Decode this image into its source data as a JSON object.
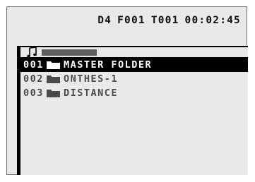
{
  "status": {
    "disc": "D4",
    "folder": "F001",
    "track": "T001",
    "time": "00:02:45"
  },
  "header": {
    "icon": "music-note-icon"
  },
  "list": {
    "items": [
      {
        "number": "001",
        "name": "MASTER FOLDER",
        "icon": "folder-icon",
        "selected": true
      },
      {
        "number": "002",
        "name": "ONTHES-1",
        "icon": "folder-icon",
        "selected": false
      },
      {
        "number": "003",
        "name": "DISTANCE",
        "icon": "folder-icon",
        "selected": false
      }
    ]
  },
  "colors": {
    "background": "#e9e9e9",
    "selection": "#000000",
    "text": "#4a4a4a",
    "selected_text": "#ffffff"
  }
}
